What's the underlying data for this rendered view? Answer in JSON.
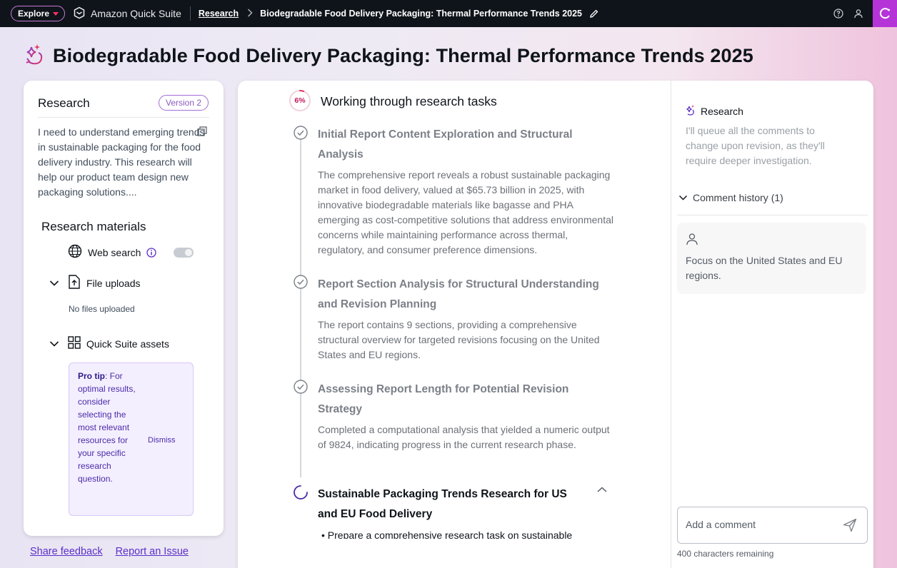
{
  "topbar": {
    "explore_label": "Explore",
    "brand": "Amazon Quick Suite",
    "breadcrumb_research": "Research",
    "breadcrumb_current": "Biodegradable Food Delivery Packaging: Thermal Performance Trends 2025"
  },
  "page": {
    "title": "Biodegradable Food Delivery Packaging: Thermal Performance Trends 2025"
  },
  "left_panel": {
    "heading": "Research",
    "version": "Version 2",
    "prompt": "I need to understand emerging trends in sustainable packaging for the food delivery industry. This research will help our product team design new packaging solutions....",
    "materials_title": "Research materials",
    "web_search": "Web search",
    "web_search_enabled": true,
    "file_uploads": "File uploads",
    "no_files": "No files uploaded",
    "quick_suite_assets": "Quick Suite assets",
    "protip_label": "Pro tip",
    "protip_text": ": For optimal results, consider selecting the most relevant resources for your specific research question.",
    "dismiss": "Dismiss"
  },
  "footer": {
    "share_feedback": "Share feedback",
    "report_issue": "Report an Issue"
  },
  "tasks": {
    "progress_label": "6%",
    "progress_value": 0.06,
    "title": "Working through research tasks",
    "items": [
      {
        "status": "done",
        "title": "Initial Report Content Exploration and Structural Analysis",
        "desc": "The comprehensive report reveals a robust sustainable packaging market in food delivery, valued at $65.73 billion in 2025, with innovative biodegradable materials like bagasse and PHA emerging as cost-competitive solutions that address environmental concerns while maintaining performance across thermal, regulatory, and consumer preference dimensions."
      },
      {
        "status": "done",
        "title": "Report Section Analysis for Structural Understanding and Revision Planning",
        "desc": "The report contains 9 sections, providing a comprehensive structural overview for targeted revisions focusing on the United States and EU regions."
      },
      {
        "status": "done",
        "title": "Assessing Report Length for Potential Revision Strategy",
        "desc": "Completed a computational analysis that yielded a numeric output of 9824, indicating progress in the current research phase."
      },
      {
        "status": "in-progress",
        "title": "Sustainable Packaging Trends Research for US and EU Food Delivery",
        "bullet": "Prepare a comprehensive research task on sustainable"
      }
    ]
  },
  "side": {
    "heading": "Research",
    "note": "I'll queue all the comments to change upon revision, as they'll require deeper investigation.",
    "comment_history": "Comment history (1)",
    "comment_text": "Focus on the United States and EU regions.",
    "add_comment_placeholder": "Add a comment",
    "chars_remaining": "400 characters remaining"
  },
  "colors": {
    "topbar_bg": "#0f141a",
    "accent_purple": "#b534d8",
    "link_purple": "#5a2fc9",
    "progress_red": "#e0335e"
  }
}
